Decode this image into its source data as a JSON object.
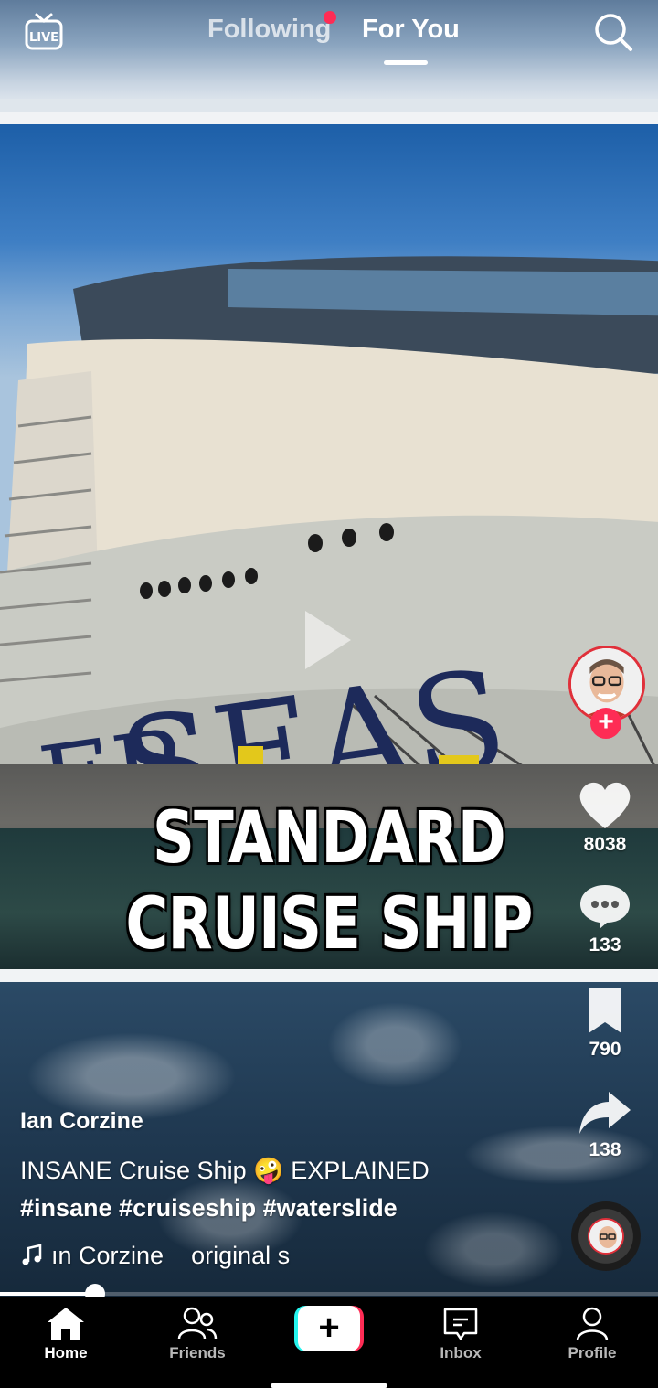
{
  "topbar": {
    "live_label": "LIVE",
    "tabs": [
      {
        "label": "Following",
        "active": false,
        "has_notification_dot": true
      },
      {
        "label": "For You",
        "active": true
      }
    ]
  },
  "video": {
    "overlay_line1": "STANDARD",
    "overlay_line2": "CRUISE SHIP",
    "paused": true,
    "progress": 0.145
  },
  "actions": {
    "likes": "8038",
    "comments": "133",
    "saves": "790",
    "shares": "138"
  },
  "caption": {
    "author": "Ian Corzine",
    "text": "INSANE Cruise Ship 🤪 EXPLAINED",
    "hashtags": "#insane #cruiseship #waterslide",
    "sound_author": "ın Corzine",
    "sound_title": "original s"
  },
  "bottomnav": {
    "items": [
      {
        "label": "Home",
        "icon": "home-icon",
        "active": true
      },
      {
        "label": "Friends",
        "icon": "friends-icon",
        "active": false
      },
      {
        "label": "Inbox",
        "icon": "inbox-icon",
        "active": false
      },
      {
        "label": "Profile",
        "icon": "profile-icon",
        "active": false
      }
    ],
    "create_symbol": "+"
  },
  "colors": {
    "accent": "#fe2c55",
    "cyan": "#25f4ee"
  }
}
